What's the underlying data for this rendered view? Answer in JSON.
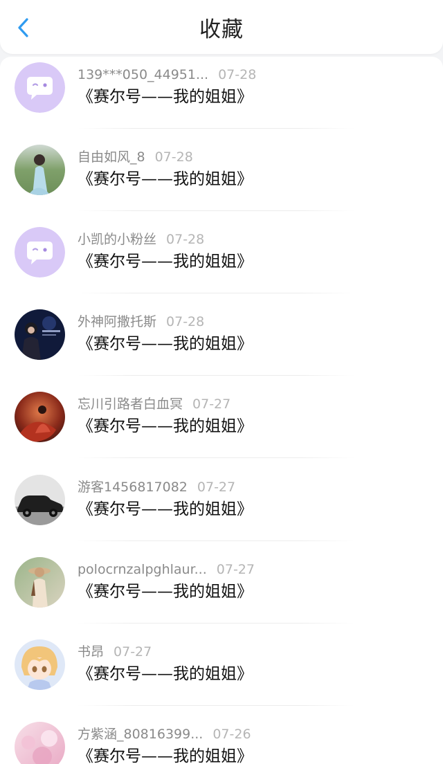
{
  "header": {
    "title": "收藏"
  },
  "items": [
    {
      "username": "139***050_44951...",
      "date": "07-28",
      "title": "《赛尔号——我的姐姐》",
      "avatar": "default-chat-avatar"
    },
    {
      "username": "自由如风_8",
      "date": "07-28",
      "title": "《赛尔号——我的姐姐》",
      "avatar": "photo-avatar"
    },
    {
      "username": "小凯的小粉丝",
      "date": "07-28",
      "title": "《赛尔号——我的姐姐》",
      "avatar": "default-chat-avatar"
    },
    {
      "username": "外神阿撒托斯",
      "date": "07-28",
      "title": "《赛尔号——我的姐姐》",
      "avatar": "photo-avatar"
    },
    {
      "username": "忘川引路者白血冥",
      "date": "07-27",
      "title": "《赛尔号——我的姐姐》",
      "avatar": "photo-avatar"
    },
    {
      "username": "游客1456817082",
      "date": "07-27",
      "title": "《赛尔号——我的姐姐》",
      "avatar": "photo-avatar"
    },
    {
      "username": "polocrnzalpghlaur...",
      "date": "07-27",
      "title": "《赛尔号——我的姐姐》",
      "avatar": "photo-avatar"
    },
    {
      "username": "书昂",
      "date": "07-27",
      "title": "《赛尔号——我的姐姐》",
      "avatar": "anime-avatar"
    },
    {
      "username": "方紫涵_80816399...",
      "date": "07-26",
      "title": "《赛尔号——我的姐姐》",
      "avatar": "photo-avatar"
    }
  ],
  "colors": {
    "accent": "#2f9bf0",
    "default_avatar_bg": "#d9c9f7"
  }
}
